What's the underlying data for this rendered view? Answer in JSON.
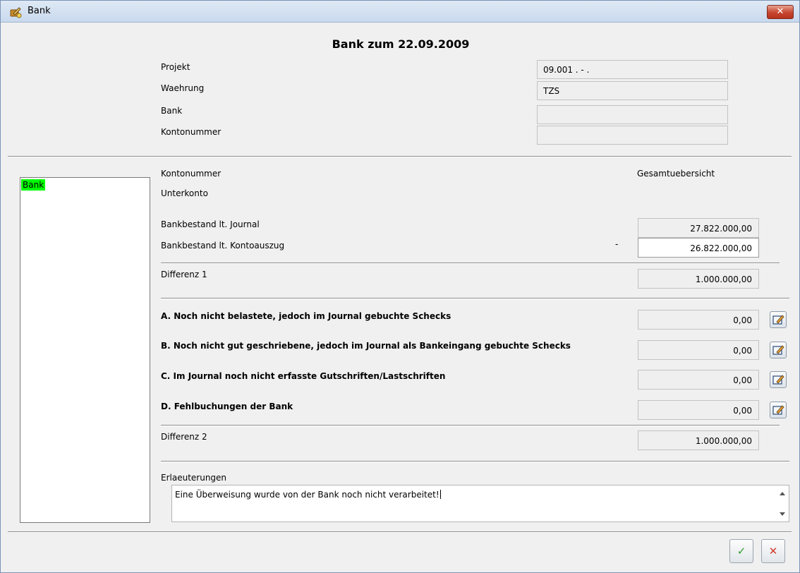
{
  "window": {
    "title": "Bank",
    "close_symbol": "✕"
  },
  "heading": "Bank zum 22.09.2009",
  "header_fields": [
    {
      "label": "Projekt",
      "value": "09.001 . -   ."
    },
    {
      "label": "Waehrung",
      "value": "TZS"
    },
    {
      "label": "Bank",
      "value": ""
    },
    {
      "label": "Kontonummer",
      "value": ""
    }
  ],
  "sidebar": {
    "items": [
      "Bank"
    ],
    "selected_color": "#00ff00"
  },
  "account": {
    "kontonummer_label": "Kontonummer",
    "unterkonto_label": "Unterkonto",
    "overview_label": "Gesamtuebersicht"
  },
  "balances": {
    "journal_label": "Bankbestand lt. Journal",
    "journal_value": "27.822.000,00",
    "statement_label": "Bankbestand lt. Kontoauszug",
    "statement_sign": "-",
    "statement_value": "26.822.000,00",
    "diff1_label": "Differenz 1",
    "diff1_value": "1.000.000,00"
  },
  "reconciliation": [
    {
      "label": "A. Noch nicht belastete, jedoch im Journal gebuchte Schecks",
      "value": "0,00",
      "icon": "edit-icon"
    },
    {
      "label": "B. Noch nicht gut geschriebene, jedoch im Journal als Bankeingang gebuchte Schecks",
      "value": "0,00",
      "icon": "edit-icon"
    },
    {
      "label": "C. Im Journal noch nicht erfasste Gutschriften/Lastschriften",
      "value": "0,00",
      "icon": "edit-icon"
    },
    {
      "label": "D. Fehlbuchungen der Bank",
      "value": "0,00",
      "icon": "edit-icon"
    }
  ],
  "diff2": {
    "label": "Differenz 2",
    "value": "1.000.000,00"
  },
  "notes": {
    "label": "Erlaeuterungen",
    "text": "Eine Überweisung wurde von der Bank noch nicht verarbeitet!"
  },
  "footer": {
    "ok_symbol": "✓",
    "cancel_symbol": "✕",
    "ok_color": "#2a9d2a",
    "cancel_color": "#d23b2b"
  }
}
